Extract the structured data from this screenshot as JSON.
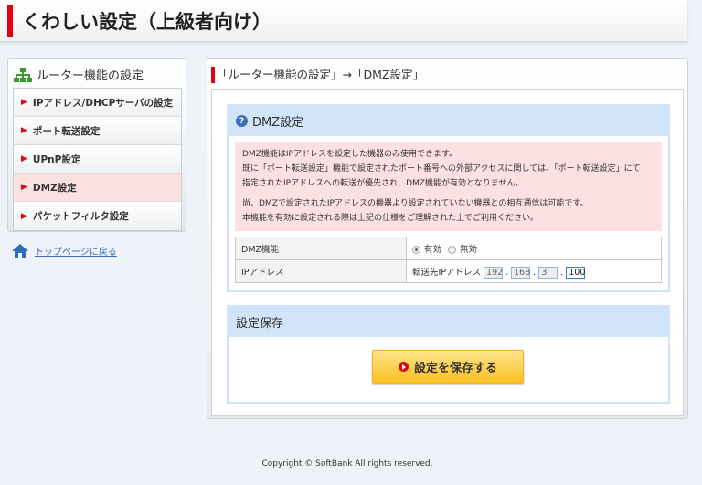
{
  "header": {
    "title": "くわしい設定（上級者向け）"
  },
  "sidebar": {
    "title": "ルーター機能の設定",
    "items": [
      {
        "label": "IPアドレス/DHCPサーバの設定"
      },
      {
        "label": "ポート転送設定"
      },
      {
        "label": "UPnP設定"
      },
      {
        "label": "DMZ設定",
        "active": true
      },
      {
        "label": "パケットフィルタ設定"
      }
    ],
    "home_link": "トップページに戻る"
  },
  "main": {
    "breadcrumb": "「ルーター機能の設定」→「DMZ設定」",
    "dmz": {
      "title": "DMZ設定",
      "note": [
        "DMZ機能はIPアドレスを設定した機器のみ使用できます。",
        "既に「ポート転送設定」機能で設定されたポート番号への外部アクセスに関しては、「ポート転送設定」にて",
        "指定されたIPアドレスへの転送が優先され、DMZ機能が有効となりません。",
        "尚、DMZで設定されたIPアドレスの機器より設定されていない機器との相互通信は可能です。",
        "本機能を有効に設定される際は上記の仕様をご理解された上でご利用ください。"
      ],
      "rows": {
        "dmz_label": "DMZ機能",
        "enable": "有効",
        "disable": "無効",
        "selected": "有効",
        "ip_label": "IPアドレス",
        "ip_prefix": "転送先IPアドレス",
        "ip": [
          "192",
          "168",
          "3",
          "100"
        ]
      }
    },
    "save": {
      "title": "設定保存",
      "button": "設定を保存する"
    }
  },
  "footer": {
    "copyright": "Copyright © SoftBank All rights reserved."
  }
}
